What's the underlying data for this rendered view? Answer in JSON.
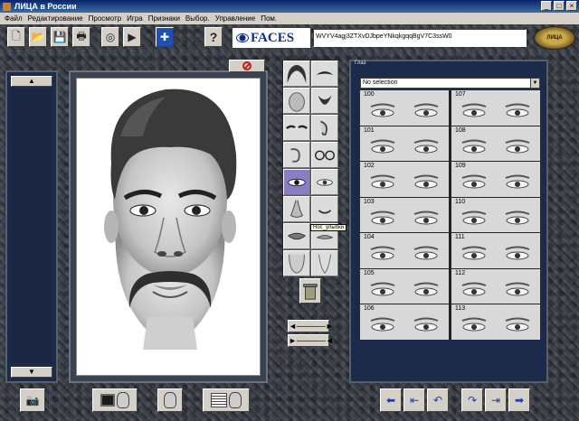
{
  "window": {
    "title": "ЛИЦА в России"
  },
  "menu": [
    "Файл",
    "Редактирование",
    "Просмотр",
    "Игра",
    "Признаки",
    "Выбор.",
    "Управление",
    "Пом."
  ],
  "toolbar": {
    "logo_text": "FACES",
    "code_value": "WVYV4agj3ZTXvDJbpeYNkqkgqqBgV7C3ssW0",
    "brand_text": "ЛИЦА"
  },
  "features_panel": {
    "tooltip": "Нос_улыбки"
  },
  "eyes_panel": {
    "caption": "Глаз",
    "selection": "No selection",
    "items": [
      "100",
      "107",
      "101",
      "108",
      "102",
      "109",
      "103",
      "110",
      "104",
      "111",
      "105",
      "112",
      "106",
      "113"
    ]
  },
  "stretch_labels": {
    "horizontal": "◄─────►",
    "compress": "►─────◄"
  },
  "colors": {
    "accent": "#0a3090",
    "panel": "#1c2b4a",
    "selected_feature": "#8a7dc4"
  }
}
